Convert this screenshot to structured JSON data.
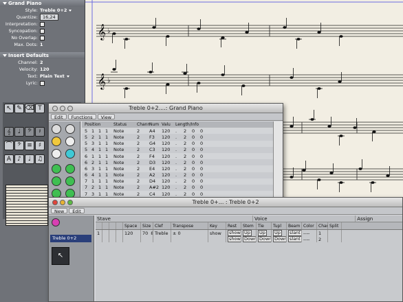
{
  "inspector": {
    "region": {
      "header": "Grand Piano",
      "style_label": "Style:",
      "style_value": "Treble 0+2",
      "quantize_label": "Quantize:",
      "quantize_value": "16,24",
      "interpretation_label": "Interpretation:",
      "syncopation_label": "Syncopation:",
      "no_overlap_label": "No Overlap:",
      "max_dots_label": "Max. Dots:",
      "max_dots_value": "1"
    },
    "insert": {
      "header": "Insert Defaults",
      "channel_label": "Channel:",
      "channel_value": "2",
      "velocity_label": "Velocity:",
      "velocity_value": "120",
      "text_label": "Text:",
      "text_value": "Plain Text",
      "lyric_label": "Lyric:"
    }
  },
  "event_list": {
    "title": "Treble 0+2....: Grand Piano",
    "menus": [
      "Edit",
      "Functions",
      "View"
    ],
    "headers": [
      "Position",
      "",
      "",
      "",
      "Status",
      "Chann",
      "Num",
      "Valu",
      "Length/Info",
      "",
      "",
      ""
    ],
    "rows": [
      [
        "5",
        "1",
        "1",
        "1",
        "Note",
        "2",
        "A4",
        "120",
        ".",
        "2",
        "0",
        "0"
      ],
      [
        "5",
        "2",
        "1",
        "1",
        "Note",
        "2",
        "F3",
        "120",
        ".",
        "2",
        "0",
        "0"
      ],
      [
        "5",
        "3",
        "1",
        "1",
        "Note",
        "2",
        "G4",
        "120",
        ".",
        "2",
        "0",
        "0"
      ],
      [
        "5",
        "4",
        "1",
        "1",
        "Note",
        "2",
        "C3",
        "120",
        ".",
        "2",
        "0",
        "0"
      ],
      [
        "6",
        "1",
        "1",
        "1",
        "Note",
        "2",
        "F4",
        "120",
        ".",
        "2",
        "0",
        "0"
      ],
      [
        "6",
        "2",
        "1",
        "1",
        "Note",
        "2",
        "D3",
        "120",
        ".",
        "2",
        "0",
        "0"
      ],
      [
        "6",
        "3",
        "1",
        "1",
        "Note",
        "2",
        "E4",
        "120",
        ".",
        "2",
        "0",
        "0"
      ],
      [
        "6",
        "4",
        "1",
        "1",
        "Note",
        "2",
        "A2",
        "120",
        ".",
        "2",
        "0",
        "0"
      ],
      [
        "7",
        "1",
        "1",
        "1",
        "Note",
        "2",
        "D4",
        "120",
        ".",
        "2",
        "0",
        "0"
      ],
      [
        "7",
        "2",
        "1",
        "1",
        "Note",
        "2",
        "A#2",
        "120",
        ".",
        "2",
        "0",
        "0"
      ],
      [
        "7",
        "3",
        "1",
        "1",
        "Note",
        "2",
        "C4",
        "120",
        ".",
        "2",
        "0",
        "0"
      ]
    ]
  },
  "staff_style": {
    "title": "Treble 0+... : Treble 0+2",
    "menus": [
      "New",
      "Edit"
    ],
    "style_name": "Treble 0+2",
    "groups": {
      "stave": "Stave",
      "voice": "Voice",
      "assign": "Assign"
    },
    "headers": [
      "",
      "",
      "",
      "",
      "Space",
      "Size",
      "Clef",
      "Transpose",
      "Key",
      "Rest",
      "Stem",
      "Tie",
      "Tupl",
      "Beam",
      "Color",
      "Chan",
      "Split"
    ],
    "rows": [
      {
        "num": "1",
        "space": "120",
        "size1": "70",
        "size2": "8",
        "clef": "Treble",
        "transpose": "± 0",
        "key": "show",
        "rest": "show",
        "stem": "Up",
        "tie": "Up",
        "tupl": "Up",
        "beam": "slant",
        "color": "----",
        "chan": "1",
        "split": ""
      },
      {
        "num": "",
        "space": "",
        "size1": "",
        "size2": "",
        "clef": "",
        "transpose": "",
        "key": "",
        "rest": "show",
        "stem": "Down",
        "tie": "Down",
        "tupl": "Down",
        "beam": "slant",
        "color": "----",
        "chan": "2",
        "split": ""
      }
    ]
  },
  "colors": {
    "score_paper": "#f2eee3",
    "inspector_bg": "#6f7278",
    "window_bg": "#d6d7db"
  }
}
